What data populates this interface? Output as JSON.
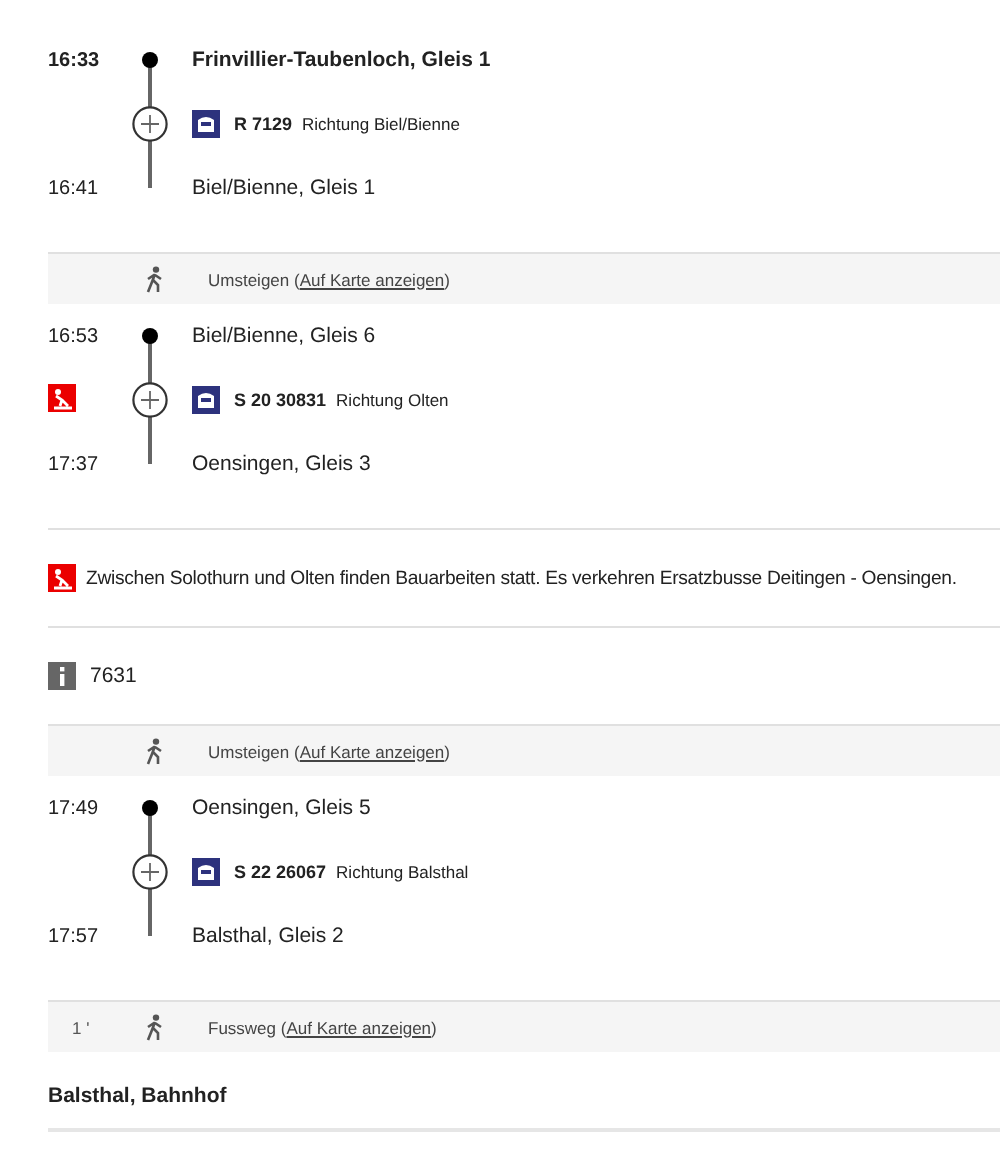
{
  "items": [
    {
      "kind": "leg",
      "origin": true,
      "dep_time": "16:33",
      "dep_stop": "Frinvillier-Taubenloch, Gleis 1",
      "train": "R 7129",
      "direction": "Richtung Biel/Bienne",
      "arr_time": "16:41",
      "arr_stop": "Biel/Bienne, Gleis 1",
      "warning": false
    },
    {
      "kind": "transfer",
      "text": "Umsteigen (",
      "link": "Auf Karte anzeigen",
      "suffix": ")"
    },
    {
      "kind": "leg",
      "origin": false,
      "dep_time": "16:53",
      "dep_stop": "Biel/Bienne, Gleis 6",
      "train": "S 20 30831",
      "direction": "Richtung Olten",
      "arr_time": "17:37",
      "arr_stop": "Oensingen, Gleis 3",
      "warning": true
    },
    {
      "kind": "notice",
      "text": "Zwischen Solothurn und Olten finden Bauarbeiten statt. Es verkehren Ersatzbusse Deitingen - Oensingen."
    },
    {
      "kind": "info",
      "text": "7631"
    },
    {
      "kind": "transfer",
      "text": "Umsteigen (",
      "link": "Auf Karte anzeigen",
      "suffix": ")"
    },
    {
      "kind": "leg",
      "origin": false,
      "dep_time": "17:49",
      "dep_stop": "Oensingen, Gleis 5",
      "train": "S 22 26067",
      "direction": "Richtung Balsthal",
      "arr_time": "17:57",
      "arr_stop": "Balsthal, Gleis 2",
      "warning": false
    },
    {
      "kind": "transfer",
      "duration": "1 '",
      "text": "Fussweg (",
      "link": "Auf Karte anzeigen",
      "suffix": ")"
    },
    {
      "kind": "destination",
      "text": "Balsthal, Bahnhof"
    }
  ]
}
